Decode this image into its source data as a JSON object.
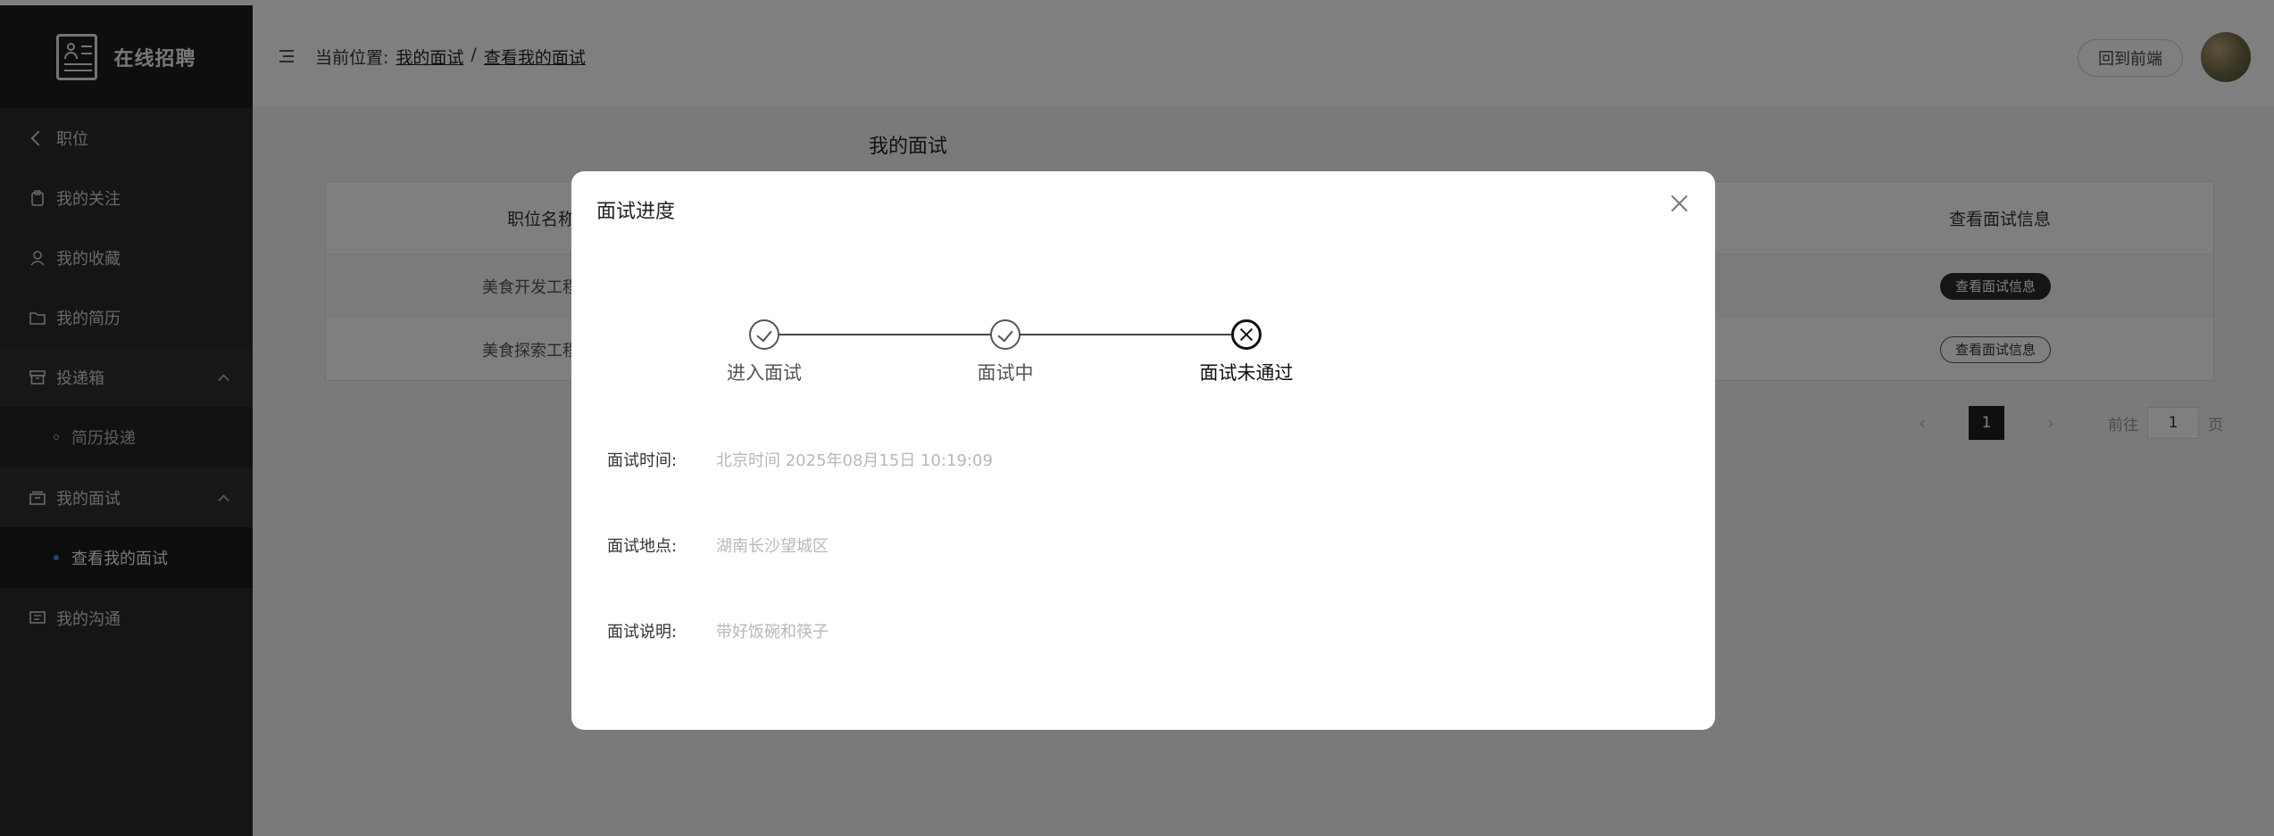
{
  "app": {
    "title": "在线招聘"
  },
  "sidebar": {
    "back_label": "职位",
    "items": [
      {
        "label": "我的关注"
      },
      {
        "label": "我的收藏"
      },
      {
        "label": "我的简历"
      },
      {
        "label": "投递箱",
        "children": [
          {
            "label": "简历投递"
          }
        ]
      },
      {
        "label": "我的面试",
        "children": [
          {
            "label": "查看我的面试"
          }
        ]
      },
      {
        "label": "我的沟通"
      }
    ]
  },
  "header": {
    "breadcrumb_prefix": "当前位置:",
    "breadcrumb": [
      "我的面试",
      "查看我的面试"
    ],
    "separator": "/",
    "front_button": "回到前端"
  },
  "main": {
    "title": "我的面试",
    "table": {
      "columns": [
        "职位名称",
        "查看面试信息"
      ],
      "rows": [
        {
          "name": "美食开发工程师",
          "action": "查看面试信息"
        },
        {
          "name": "美食探索工程师",
          "action": "查看面试信息"
        }
      ]
    },
    "pager": {
      "current": "1",
      "goto_prefix": "前往",
      "goto_value": "1",
      "goto_suffix": "页"
    }
  },
  "dialog": {
    "title": "面试进度",
    "steps": [
      {
        "label": "进入面试",
        "state": "done"
      },
      {
        "label": "面试中",
        "state": "done"
      },
      {
        "label": "面试未通过",
        "state": "fail"
      }
    ],
    "info": [
      {
        "label": "面试时间:",
        "value": "北京时间 2025年08月15日 10:19:09"
      },
      {
        "label": "面试地点:",
        "value": "湖南长沙望城区"
      },
      {
        "label": "面试说明:",
        "value": "带好饭碗和筷子"
      }
    ]
  },
  "colors": {
    "sidebar_bg": "#2a2a2a",
    "active_dot": "#3f8cff",
    "overlay": "rgba(0,0,0,0.5)"
  }
}
